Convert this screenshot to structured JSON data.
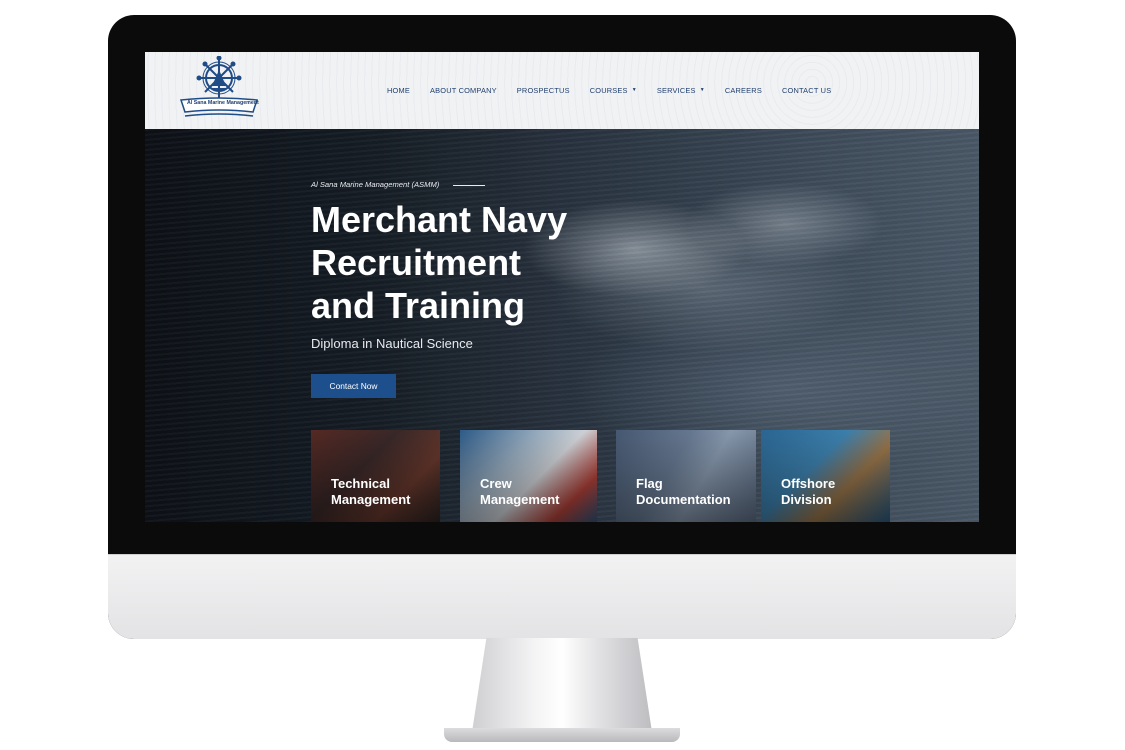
{
  "site": {
    "logo_text": "Al Sana Marine Management",
    "nav": [
      {
        "label": "HOME",
        "has_dropdown": false
      },
      {
        "label": "ABOUT COMPANY",
        "has_dropdown": false
      },
      {
        "label": "PROSPECTUS",
        "has_dropdown": false
      },
      {
        "label": "COURSES",
        "has_dropdown": true
      },
      {
        "label": "SERVICES",
        "has_dropdown": true
      },
      {
        "label": "CAREERS",
        "has_dropdown": false
      },
      {
        "label": "CONTACT US",
        "has_dropdown": false
      }
    ]
  },
  "hero": {
    "eyebrow": "Al Sana Marine Management (ASMM)",
    "title": "Merchant Navy\nRecruitment\nand Training",
    "subtitle": "Diploma in Nautical Science",
    "cta_label": "Contact Now"
  },
  "cards": [
    {
      "label": "Technical\nManagement"
    },
    {
      "label": "Crew\nManagement"
    },
    {
      "label": "Flag\nDocumentation"
    },
    {
      "label": "Offshore\nDivision"
    }
  ],
  "colors": {
    "brand_blue": "#1e4f8d",
    "nav_text": "#1f3f6e",
    "header_bg": "#eceef1"
  }
}
